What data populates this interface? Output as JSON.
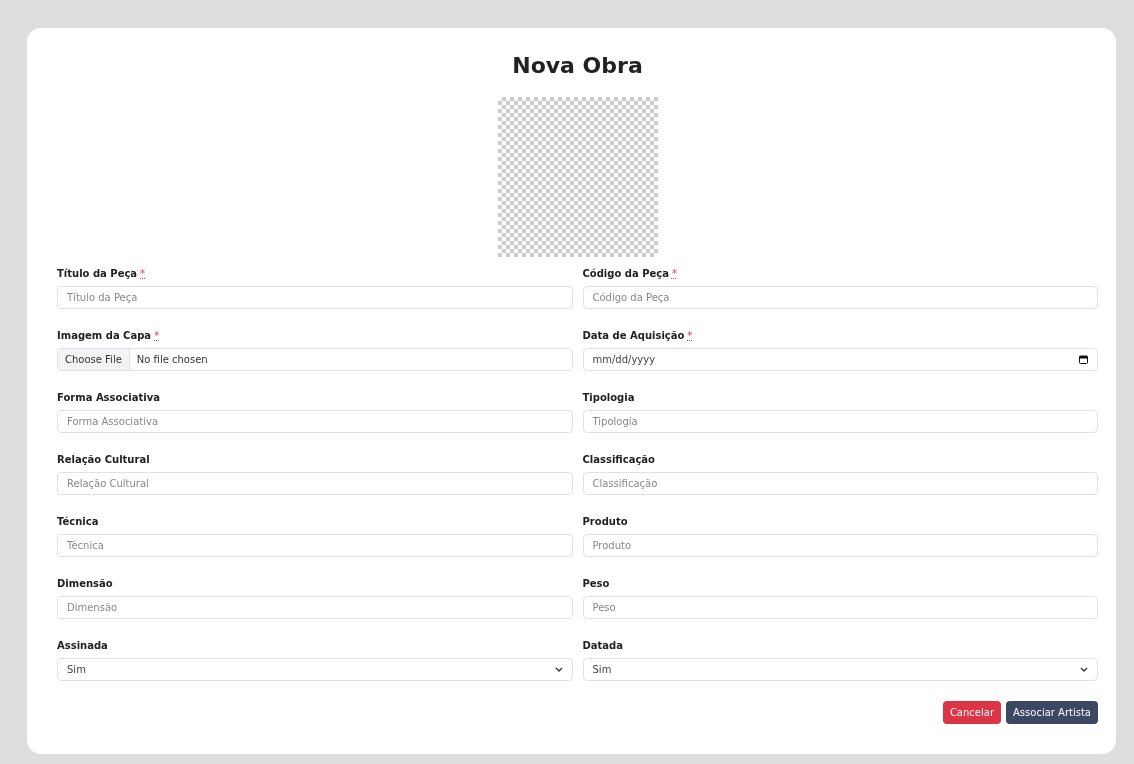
{
  "title": "Nova Obra",
  "fields": [
    {
      "label": "Título da Peça",
      "required": true,
      "kind": "text",
      "placeholder": "Título da Peça"
    },
    {
      "label": "Código da Peça",
      "required": true,
      "kind": "text",
      "placeholder": "Código da Peça"
    },
    {
      "label": "Imagem da Capa",
      "required": true,
      "kind": "file",
      "button": "Choose File",
      "value": "No file chosen"
    },
    {
      "label": "Data de Aquisição",
      "required": true,
      "kind": "date",
      "placeholder": "mm/dd/yyyy"
    },
    {
      "label": "Forma Associativa",
      "required": false,
      "kind": "text",
      "placeholder": "Forma Associativa"
    },
    {
      "label": "Tipologia",
      "required": false,
      "kind": "text",
      "placeholder": "Tipologia"
    },
    {
      "label": "Relação Cultural",
      "required": false,
      "kind": "text",
      "placeholder": "Relação Cultural"
    },
    {
      "label": "Classificação",
      "required": false,
      "kind": "text",
      "placeholder": "Classificação"
    },
    {
      "label": "Técnica",
      "required": false,
      "kind": "text",
      "placeholder": "Técnica"
    },
    {
      "label": "Produto",
      "required": false,
      "kind": "text",
      "placeholder": "Produto"
    },
    {
      "label": "Dimensão",
      "required": false,
      "kind": "text",
      "placeholder": "Dimensão"
    },
    {
      "label": "Peso",
      "required": false,
      "kind": "text",
      "placeholder": "Peso"
    },
    {
      "label": "Assinada",
      "required": false,
      "kind": "select",
      "value": "Sim"
    },
    {
      "label": "Datada",
      "required": false,
      "kind": "select",
      "value": "Sim"
    }
  ],
  "required_mark": "*",
  "buttons": [
    {
      "label": "Cancelar",
      "kind": "danger"
    },
    {
      "label": "Associar Artista",
      "kind": "primary"
    }
  ]
}
